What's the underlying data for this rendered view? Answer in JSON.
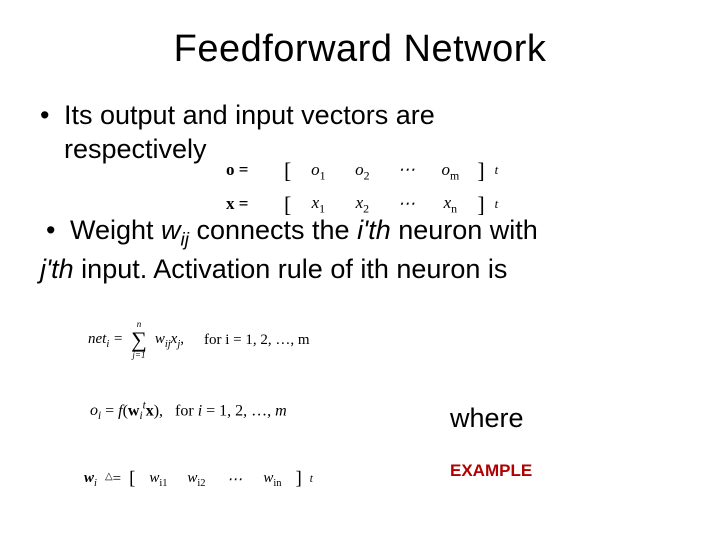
{
  "title": "Feedforward Network",
  "bullet1_a": "Its output and input vectors are",
  "bullet1_b": "respectively",
  "bullet2_a": "Weight ",
  "bullet2_w": "w",
  "bullet2_ij": "ij",
  "bullet2_b": " connects the ",
  "bullet2_ith": "i'th",
  "bullet2_c": " neuron with",
  "bullet2_jth": "j'th",
  "bullet2_d": " input. Activation rule of ith neuron is",
  "where": "where",
  "example": "EXAMPLE",
  "eq_o": {
    "lhs": "o",
    "elems": [
      "o₁",
      "o₂",
      "⋯",
      "oₘ"
    ],
    "sup": "t"
  },
  "eq_x": {
    "lhs": "x",
    "elems": [
      "x₁",
      "x₂",
      "⋯",
      "xₙ"
    ],
    "sup": "t"
  },
  "eq_net": {
    "lhs": "netᵢ",
    "sum_top": "n",
    "sum_bot": "j=1",
    "term": "wᵢⱼxⱼ,",
    "tail": "for i = 1, 2, …, m"
  },
  "eq_oi": {
    "text": "oᵢ = f(wᵢᵗx),   for i = 1, 2, …, m"
  },
  "eq_wi": {
    "lhs": "wᵢ",
    "elems": [
      "wᵢ₁",
      "wᵢ₂",
      "⋯",
      "wᵢₙ"
    ],
    "sup": "t"
  }
}
